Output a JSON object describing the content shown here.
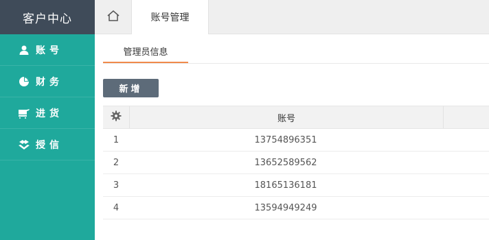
{
  "brand": {
    "title": "客户中心"
  },
  "sidebar": {
    "items": [
      {
        "label": "账号",
        "icon": "user-icon"
      },
      {
        "label": "财务",
        "icon": "pie-chart-icon"
      },
      {
        "label": "进货",
        "icon": "cart-icon"
      },
      {
        "label": "授信",
        "icon": "handshake-icon"
      }
    ]
  },
  "tabs": {
    "home_icon": "home-icon",
    "active": "账号管理"
  },
  "subtab": {
    "label": "管理员信息"
  },
  "toolbar": {
    "add_label": "新增"
  },
  "table": {
    "settings_icon": "gear-icon",
    "header_account": "账号",
    "rows": [
      {
        "index": "1",
        "account": "13754896351"
      },
      {
        "index": "2",
        "account": "13652589562"
      },
      {
        "index": "3",
        "account": "18165136181"
      },
      {
        "index": "4",
        "account": "13594949249"
      }
    ]
  },
  "colors": {
    "sidebar": "#1fa99c",
    "brand_bg": "#3f4b59",
    "accent": "#f08a4b",
    "button": "#5d6b79"
  }
}
